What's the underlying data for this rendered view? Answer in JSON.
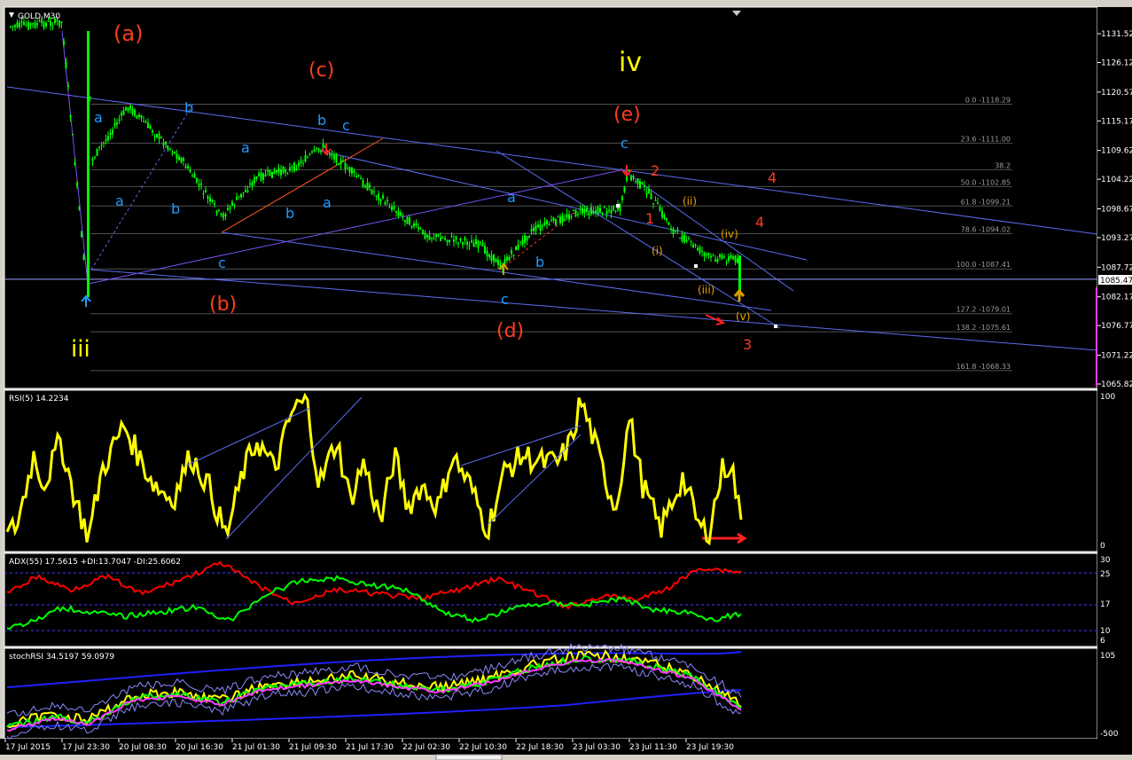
{
  "colors": {
    "bg": "#000000",
    "frame": "#ffffff",
    "candle": "#00ff00",
    "rsi": "#ffff00",
    "adx_plus": "#00ff00",
    "adx_minus": "#ff0000",
    "channel": "#5a6cf0",
    "fib": "#4f4f4f",
    "red_label": "#ff3b1f",
    "blue_label": "#1e9bff",
    "yellow_label": "#ffff00",
    "orange_label": "#e6a200"
  },
  "main": {
    "symbol": "GOLD,M30",
    "price_labels": [
      "1131.52",
      "1126.12",
      "1120.57",
      "1115.17",
      "1109.62",
      "1104.22",
      "1098.67",
      "1093.27",
      "1087.72",
      "1082.17",
      "1076.77",
      "1071.22",
      "1065.82"
    ],
    "current_price": "1085.47",
    "fib_levels": [
      "0.0 -1118.29",
      "23.6 -1111.00",
      "38.2",
      "50.0 -1102.85",
      "61.8 -1099.21",
      "78.6 -1094.02",
      "100.0 -1087.41",
      "127.2 -1079.01",
      "138.2 -1075.61",
      "161.8 -1068.33"
    ],
    "wave_labels": {
      "red": [
        "(a)",
        "(b)",
        "(c)",
        "(d)",
        "(e)",
        "1",
        "2",
        "3",
        "4",
        "4"
      ],
      "yellow": [
        "iii",
        "iv"
      ],
      "blue": [
        "a",
        "b",
        "a",
        "b",
        "c",
        "a",
        "b",
        "a",
        "b",
        "c",
        "c",
        "a",
        "b",
        "c",
        "b",
        "c"
      ],
      "orange": [
        "(i)",
        "(ii)",
        "(iii)",
        "(iv)",
        "(v)"
      ]
    }
  },
  "rsi": {
    "title": "RSI(5) 14.2234",
    "max": "100",
    "min": "0"
  },
  "adx": {
    "title": "ADX(55) 17.5615 +DI:13.7047 -DI:25.6062",
    "levels": [
      "30",
      "25",
      "17",
      "10",
      "6"
    ]
  },
  "stoch": {
    "title": "stochRSI 34.5197 59.0979",
    "levels": [
      "105",
      "-500"
    ]
  },
  "x_axis": [
    "17 Jul 2015",
    "17 Jul 23:30",
    "20 Jul 08:30",
    "20 Jul 16:30",
    "21 Jul 01:30",
    "21 Jul 09:30",
    "21 Jul 17:30",
    "22 Jul 02:30",
    "22 Jul 10:30",
    "22 Jul 18:30",
    "23 Jul 03:30",
    "23 Jul 11:30",
    "23 Jul 19:30"
  ],
  "chart_data": [
    {
      "type": "line",
      "title": "GOLD,M30",
      "xlabel": "",
      "ylabel": "",
      "x": [
        "17 Jul 2015",
        "17 Jul 23:30",
        "20 Jul 08:30",
        "20 Jul 16:30",
        "21 Jul 01:30",
        "21 Jul 09:30",
        "21 Jul 17:30",
        "22 Jul 02:30",
        "22 Jul 10:30",
        "22 Jul 18:30",
        "23 Jul 03:30",
        "23 Jul 11:30",
        "23 Jul 19:30"
      ],
      "series": [
        {
          "name": "GOLD,M30",
          "values": [
            1133,
            1084,
            1117,
            1101,
            1097,
            1108,
            1104,
            1092,
            1088,
            1093,
            1104,
            1093,
            1086
          ]
        }
      ],
      "ylim": [
        1065.82,
        1134
      ]
    },
    {
      "type": "line",
      "title": "RSI(5) 14.2234",
      "x": [
        "17 Jul 2015",
        "17 Jul 23:30",
        "20 Jul 08:30",
        "20 Jul 16:30",
        "21 Jul 01:30",
        "21 Jul 09:30",
        "21 Jul 17:30",
        "22 Jul 02:30",
        "22 Jul 10:30",
        "22 Jul 18:30",
        "23 Jul 03:30",
        "23 Jul 11:30",
        "23 Jul 19:30"
      ],
      "series": [
        {
          "name": "RSI(5)",
          "values": [
            5,
            20,
            65,
            35,
            5,
            95,
            35,
            30,
            10,
            60,
            90,
            35,
            14
          ]
        }
      ],
      "ylim": [
        0,
        100
      ]
    }
  ]
}
